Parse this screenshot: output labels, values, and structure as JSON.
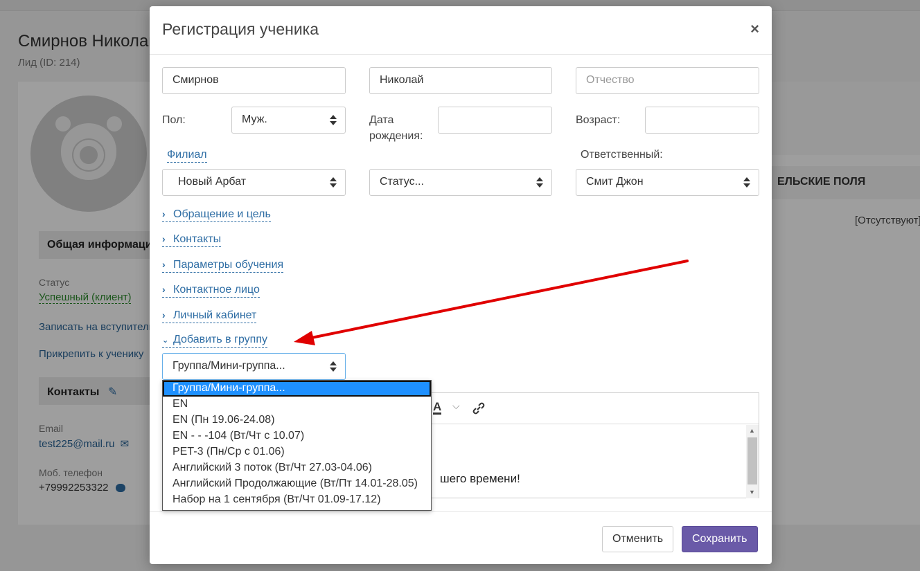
{
  "background": {
    "person_name": "Смирнов Николай",
    "lead_id": "Лид (ID: 214)",
    "section_general": "Общая информация",
    "status_label": "Статус",
    "status_value": "Успешный (клиент)",
    "enroll_link": "Записать на вступительное",
    "attach_link": "Прикрепить к ученику",
    "section_contacts": "Контакты",
    "email_label": "Email",
    "email_value": "test225@mail.ru",
    "phone_label": "Моб. телефон",
    "phone_value": "+79992253322",
    "custom_fields_header": "ЕЛЬСКИЕ ПОЛЯ",
    "custom_fields_value": "[Отсутствуют]"
  },
  "modal": {
    "title": "Регистрация ученика",
    "close_symbol": "×",
    "last_name": "Смирнов",
    "first_name": "Николай",
    "middle_name_placeholder": "Отчество",
    "gender_label": "Пол:",
    "gender_value": "Муж.",
    "birthdate_label": "Дата рождения:",
    "age_label": "Возраст:",
    "branch_label": "Филиал",
    "responsible_label": "Ответственный:",
    "branch_value": "Новый Арбат",
    "status_value": "Статус...",
    "responsible_value": "Смит Джон",
    "sections": [
      {
        "label": "Обращение и цель",
        "expanded": false
      },
      {
        "label": "Контакты",
        "expanded": false
      },
      {
        "label": "Параметры обучения",
        "expanded": false
      },
      {
        "label": "Контактное лицо",
        "expanded": false
      },
      {
        "label": "Личный кабинет",
        "expanded": false
      },
      {
        "label": "Добавить в группу",
        "expanded": true
      }
    ],
    "group_select_value": "Группа/Мини-группа...",
    "group_options": [
      "Группа/Мини-группа...",
      "EN",
      "EN (Пн 19.06-24.08)",
      "EN - - -104 (Вт/Чт с 10.07)",
      "PET-3 (Пн/Ср с 01.06)",
      "Английский 3 поток (Вт/Чт 27.03-04.06)",
      "Английский Продолжающие (Вт/Пт 14.01-28.05)",
      "Набор на 1 сентября (Вт/Чт 01.09-17.12)"
    ],
    "selected_option_index": 0,
    "editor_text_visible": "шего времени!",
    "editor_font_color_glyph": "A",
    "cancel_label": "Отменить",
    "save_label": "Сохранить"
  },
  "colors": {
    "accent": "#6a5aa8",
    "link": "#2e6da4",
    "highlight": "#1e90ff",
    "annotation_arrow": "#e00000",
    "status_green": "#2a8a2a"
  },
  "icons": {
    "close": "close-icon",
    "pencil": "pencil-icon",
    "envelope": "envelope-icon",
    "chat": "chat-icon",
    "link": "link-icon",
    "chevron_right": "chevron-right-icon",
    "chevron_down": "chevron-down-icon"
  }
}
